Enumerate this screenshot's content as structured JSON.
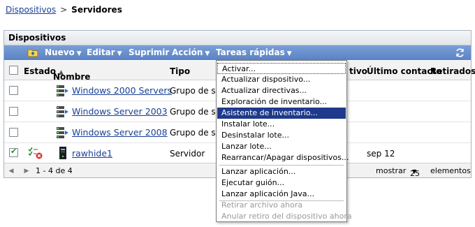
{
  "breadcrumb": {
    "link": "Dispositivos",
    "separator": ">",
    "current": "Servidores"
  },
  "panel": {
    "title": "Dispositivos"
  },
  "toolbar": {
    "new": "Nuevo",
    "edit": "Editar",
    "delete": "Suprimir",
    "action": "Acción",
    "quick": "Tareas rápidas"
  },
  "table": {
    "headers": {
      "status": "Estado",
      "name": "Nombre",
      "type": "Tipo",
      "partial": "tivo",
      "last_contact": "Último contacto",
      "retired": "Retirados"
    },
    "rows": [
      {
        "name": "Windows 2000 Servers",
        "type": "Grupo de se",
        "last_contact": "",
        "checked": false
      },
      {
        "name": "Windows Server 2003",
        "type": "Grupo de se",
        "last_contact": "",
        "checked": false
      },
      {
        "name": "Windows Server 2008",
        "type": "Grupo de se",
        "last_contact": "",
        "checked": false
      },
      {
        "name": "rawhide1",
        "type": "Servidor",
        "last_contact": "sep 12",
        "checked": true
      }
    ]
  },
  "footer": {
    "range": "1 - 4 de 4",
    "show": "mostrar",
    "count": "25",
    "items": "elementos"
  },
  "menu": {
    "items": [
      "Activar...",
      "Actualizar dispositivo...",
      "Actualizar directivas...",
      "Exploración de inventario...",
      "Asistente de inventario...",
      "Instalar lote...",
      "Desinstalar lote...",
      "Lanzar lote...",
      "Rearrancar/Apagar dispositivos...",
      "Lanzar aplicación...",
      "Ejecutar guión...",
      "Lanzar aplicación Java...",
      "Retirar archivo ahora",
      "Anular retiro del dispositivo ahora"
    ]
  }
}
